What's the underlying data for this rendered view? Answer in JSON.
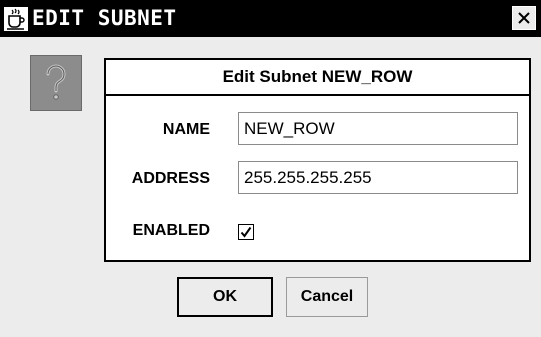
{
  "window": {
    "title": "EDIT SUBNET",
    "icons": {
      "app": "coffee-cup-icon",
      "close": "close-icon",
      "help": "question-mark-icon"
    }
  },
  "panel": {
    "header": "Edit Subnet  NEW_ROW",
    "fields": {
      "name": {
        "label": "NAME",
        "value": "NEW_ROW"
      },
      "address": {
        "label": "ADDRESS",
        "value": "255.255.255.255"
      },
      "enabled": {
        "label": "ENABLED",
        "checked": true
      }
    }
  },
  "buttons": {
    "ok": "OK",
    "cancel": "Cancel"
  },
  "colors": {
    "titlebar": "#000000",
    "background": "#ececec",
    "panel": "#ffffff",
    "help_icon_bg": "#8c8c8c"
  }
}
